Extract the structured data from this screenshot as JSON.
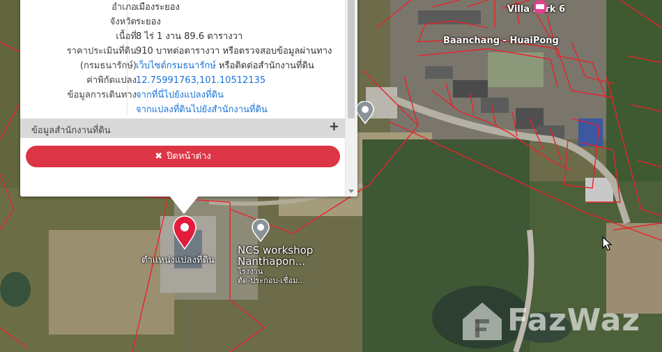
{
  "popup": {
    "rows": [
      {
        "label": "อำเภอ",
        "value": "เมืองระยอง",
        "link": false
      },
      {
        "label": "จังหวัด",
        "value": "ระยอง",
        "link": false
      },
      {
        "label": "เนื้อที่",
        "value": "8 ไร่ 1 งาน 89.6 ตารางวา",
        "link": false
      },
      {
        "label": "ราคาประเมินที่ดิน",
        "value": "910 บาทต่อตารางวา หรือตรวจสอบข้อมูลผ่านทาง",
        "link": false
      },
      {
        "label": "(กรมธนารักษ์)",
        "value": "เว็บไซต์กรมธนารักษ์",
        "value_suffix": " หรือติดต่อสำนักงานที่ดิน",
        "link": true
      },
      {
        "label": "ค่าพิกัดแปลง",
        "value": "12.75991763,101.10512135",
        "link": true
      },
      {
        "label": "ข้อมูลการเดินทาง",
        "value": "จากที่นี่ไปยังแปลงที่ดิน",
        "link": true
      },
      {
        "label": "",
        "value": "จากแปลงที่ดินไปยังสำนักงานที่ดิน",
        "link": true
      }
    ],
    "land_office_label": "ข้อมูลสำนักงานที่ดิน",
    "expand_symbol": "+",
    "close_button": {
      "icon": "✖",
      "label": "ปิดหน้าต่าง"
    }
  },
  "map": {
    "resort_name": "Villa Park 6",
    "resort_name2": "Baanchang - HuaiPong",
    "poi_name_line1": "NCS workshop",
    "poi_name_line2": "Nanthapon...",
    "poi_category_line1": "โรงงาน",
    "poi_category_line2": "ตัด-ประกอบ-เชื่อม...",
    "parcel_pin_label": "ตำแหน่งแปลงที่ดิน",
    "watermark_text": "FazWaz",
    "colors": {
      "parcel_lines": "#e8232b",
      "pin": "#e31b3c",
      "close_button": "#dc3545",
      "link": "#1a73d6"
    }
  }
}
